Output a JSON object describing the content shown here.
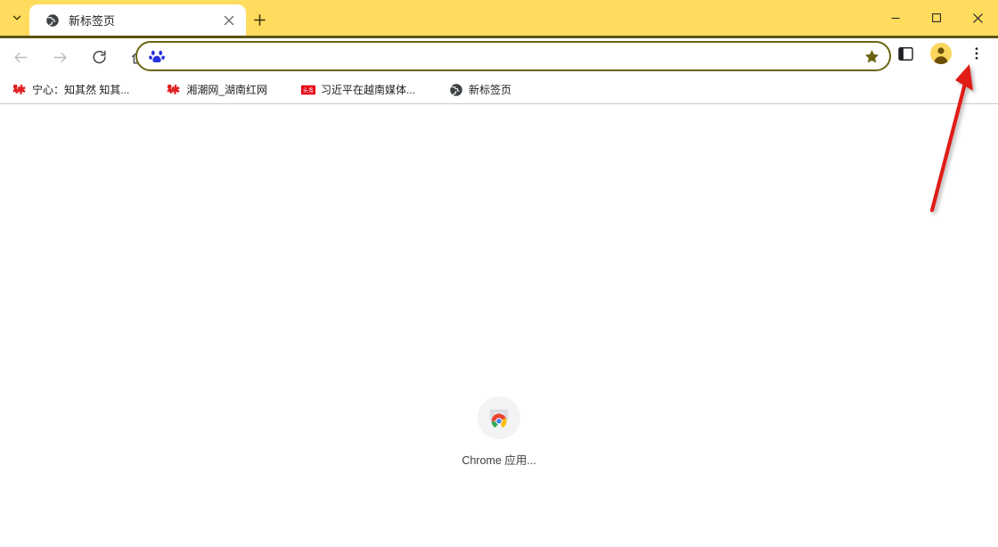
{
  "window": {
    "titlebar_color": "#FFDC5E",
    "controls": [
      {
        "name": "minimize",
        "glyph": "—"
      },
      {
        "name": "maximize",
        "glyph": "□"
      },
      {
        "name": "close",
        "glyph": "✕"
      }
    ]
  },
  "tabstrip": {
    "tab_search_tooltip": "搜索标签页",
    "new_tab_tooltip": "新建标签页",
    "tabs": [
      {
        "title": "新标签页",
        "favicon": "globe-icon",
        "active": true,
        "close_glyph": "✕"
      }
    ]
  },
  "toolbar": {
    "back_label": "后退",
    "forward_label": "前进",
    "reload_label": "重新加载",
    "home_label": "主页",
    "side_panel_label": "侧边栏",
    "profile_label": "个人资料",
    "menu_label": "自定义及控制 Google Chrome",
    "omnibox": {
      "value": "",
      "placeholder": "",
      "leading_icon": "baidu-paw-icon",
      "bookmark_star": "star-filled-icon",
      "border_color": "#6B6410",
      "star_color": "#6B6410"
    }
  },
  "bookmarks_bar": {
    "items": [
      {
        "label": "宁心：知其然 知其...",
        "icon": "red-logo-icon"
      },
      {
        "label": "湘潮网_湖南红网",
        "icon": "red-logo-icon"
      },
      {
        "label": "习近平在越南媒体...",
        "icon": "toutiao-icon",
        "icon_text": "头条"
      },
      {
        "label": "新标签页",
        "icon": "globe-icon"
      }
    ]
  },
  "page": {
    "shortcut": {
      "label": "Chrome 应用...",
      "icon": "chrome-apps-icon"
    }
  },
  "annotation": {
    "type": "arrow",
    "color": "#E01B17",
    "points_to": "chrome-menu-button"
  }
}
